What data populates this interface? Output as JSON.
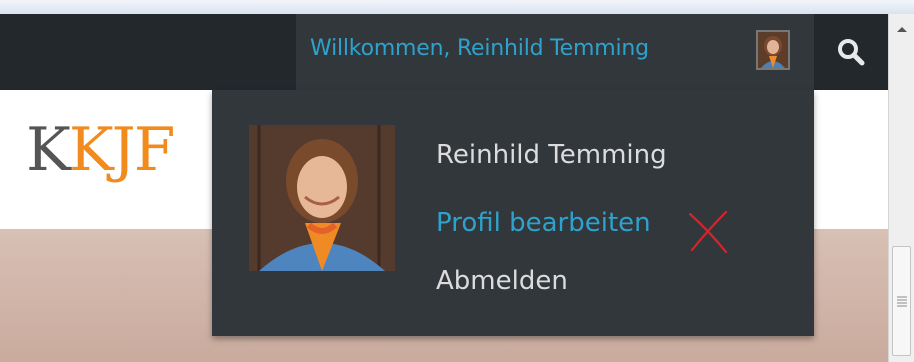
{
  "adminbar": {
    "welcome_text": "Willkommen, Reinhild Temming",
    "search_icon": "search-icon"
  },
  "site": {
    "logo_first": "K",
    "logo_rest": "KJF"
  },
  "account_menu": {
    "user_name": "Reinhild Temming",
    "edit_profile": "Profil bearbeiten",
    "logout": "Abmelden"
  },
  "annotation": {
    "mark": "x-mark-icon",
    "color": "#d8232a"
  },
  "colors": {
    "adminbar_bg": "#23282d",
    "menu_bg": "#32373c",
    "link": "#2ea2cc",
    "logo_orange": "#f28b1d",
    "logo_gray": "#555555"
  }
}
